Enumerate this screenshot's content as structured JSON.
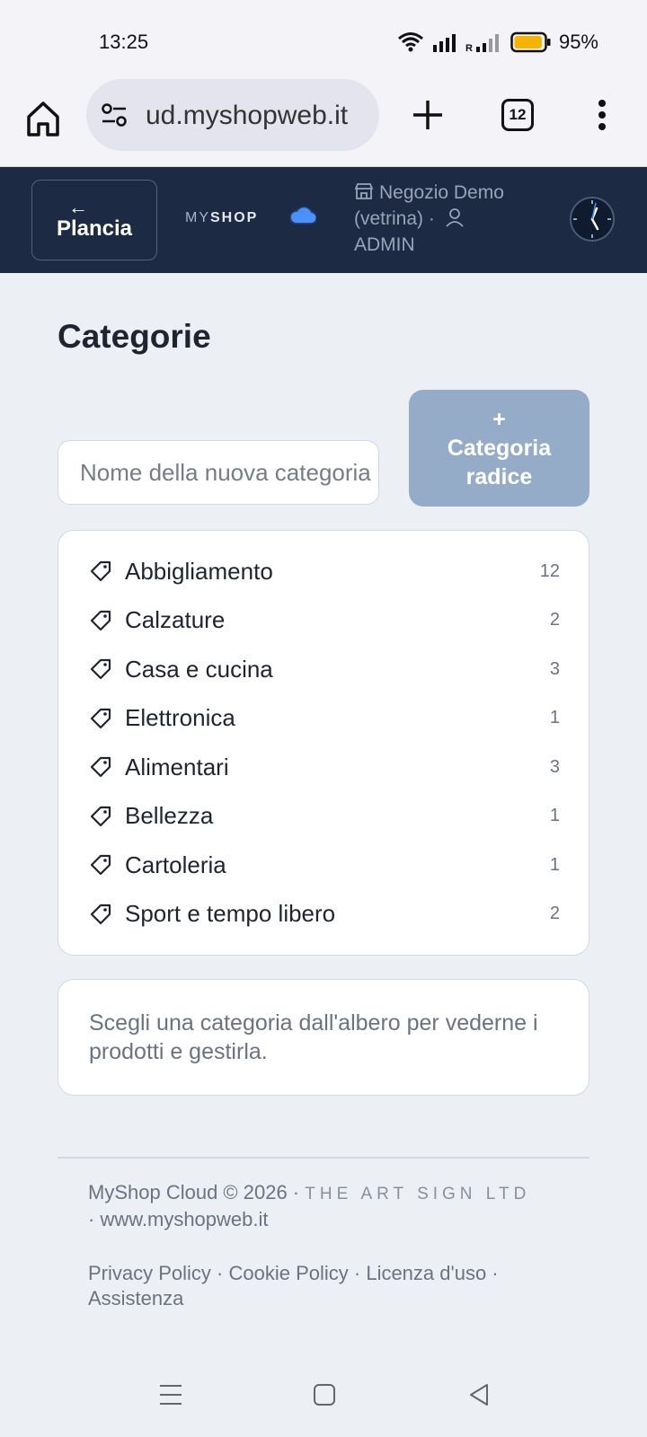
{
  "status_bar": {
    "time": "13:25",
    "battery_percent": "95%",
    "battery_level": 0.95,
    "icons": [
      "wifi-icon",
      "signal-icon",
      "signal-r-icon",
      "battery-icon"
    ]
  },
  "browser": {
    "url": "ud.myshopweb.it",
    "tabs_count": "12",
    "icons": [
      "home-icon",
      "site-settings-icon",
      "new-tab-icon",
      "tabs-icon",
      "more-vert-icon"
    ]
  },
  "header": {
    "back_arrow": "←",
    "back_label": "Plancia",
    "brand_light": "MY",
    "brand_bold": "SHOP",
    "shop_name": "Negozio Demo (vetrina) ·",
    "user_role": "ADMIN",
    "colors": {
      "bg": "#1c2a44",
      "cloud": "#4a90ff"
    }
  },
  "page": {
    "title": "Categorie",
    "new_category_placeholder": "Nome della nuova categoria",
    "root_button_plus": "+",
    "root_button_label": "Categoria radice",
    "hint": "Scegli una categoria dall'albero per vederne i prodotti e gestirla."
  },
  "categories": [
    {
      "name": "Abbigliamento",
      "count": "12"
    },
    {
      "name": "Calzature",
      "count": "2"
    },
    {
      "name": "Casa e cucina",
      "count": "3"
    },
    {
      "name": "Elettronica",
      "count": "1"
    },
    {
      "name": "Alimentari",
      "count": "3"
    },
    {
      "name": "Bellezza",
      "count": "1"
    },
    {
      "name": "Cartoleria",
      "count": "1"
    },
    {
      "name": "Sport e tempo libero",
      "count": "2"
    }
  ],
  "footer": {
    "copyright": "MyShop Cloud © 2026 ·",
    "company": "THE ART SIGN LTD",
    "website": "· www.myshopweb.it",
    "links": [
      "Privacy Policy",
      "Cookie Policy",
      "Licenza d'uso",
      "Assistenza"
    ]
  },
  "nav_icons": [
    "recents-icon",
    "home-square-icon",
    "back-triangle-icon"
  ]
}
